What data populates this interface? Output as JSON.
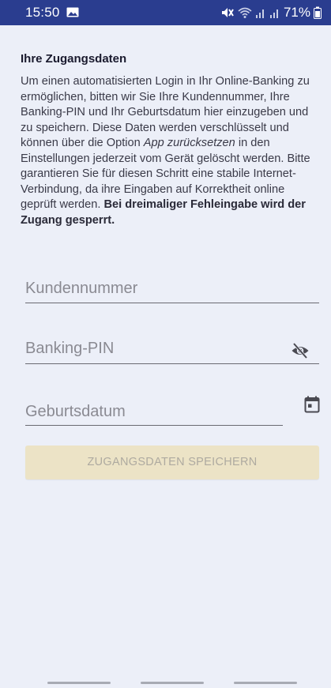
{
  "status_bar": {
    "time": "15:50",
    "battery": "71%",
    "icons": [
      "image-icon",
      "mute-icon",
      "wifi-icon",
      "signal-icon",
      "signal-icon",
      "battery-icon"
    ]
  },
  "page": {
    "section_title": "Ihre Zugangsdaten",
    "intro": {
      "part1": "Um einen automatisierten Login in Ihr Online-Banking zu ermöglichen, bitten wir Sie Ihre Kundennummer, Ihre Banking-PIN und Ihr Geburtsdatum hier einzugeben und zu speichern. Diese Daten werden verschlüsselt und können über die Option ",
      "italic": "App zurücksetzen",
      "part2": " in den Einstellungen jederzeit vom Gerät gelöscht werden. Bitte garantieren Sie für diesen Schritt eine stabile Internet-Verbindung, da ihre Eingaben auf Korrektheit online geprüft werden. ",
      "bold": "Bei dreimaliger Fehleingabe wird der Zugang gesperrt."
    }
  },
  "form": {
    "customer_number": {
      "placeholder": "Kundennummer",
      "value": ""
    },
    "pin": {
      "placeholder": "Banking-PIN",
      "value": "",
      "visibility_icon": "eye-off-icon"
    },
    "birthdate": {
      "placeholder": "Geburtsdatum",
      "value": "",
      "picker_icon": "calendar-icon"
    },
    "save_label": "ZUGANGSDATEN SPEICHERN"
  },
  "colors": {
    "status_bar": "#2a3d8f",
    "background": "#eceff8",
    "button_disabled": "#ece3c6",
    "button_text_disabled": "#aeaaa0",
    "text": "#3a3a48",
    "hint": "#8a8a92"
  }
}
